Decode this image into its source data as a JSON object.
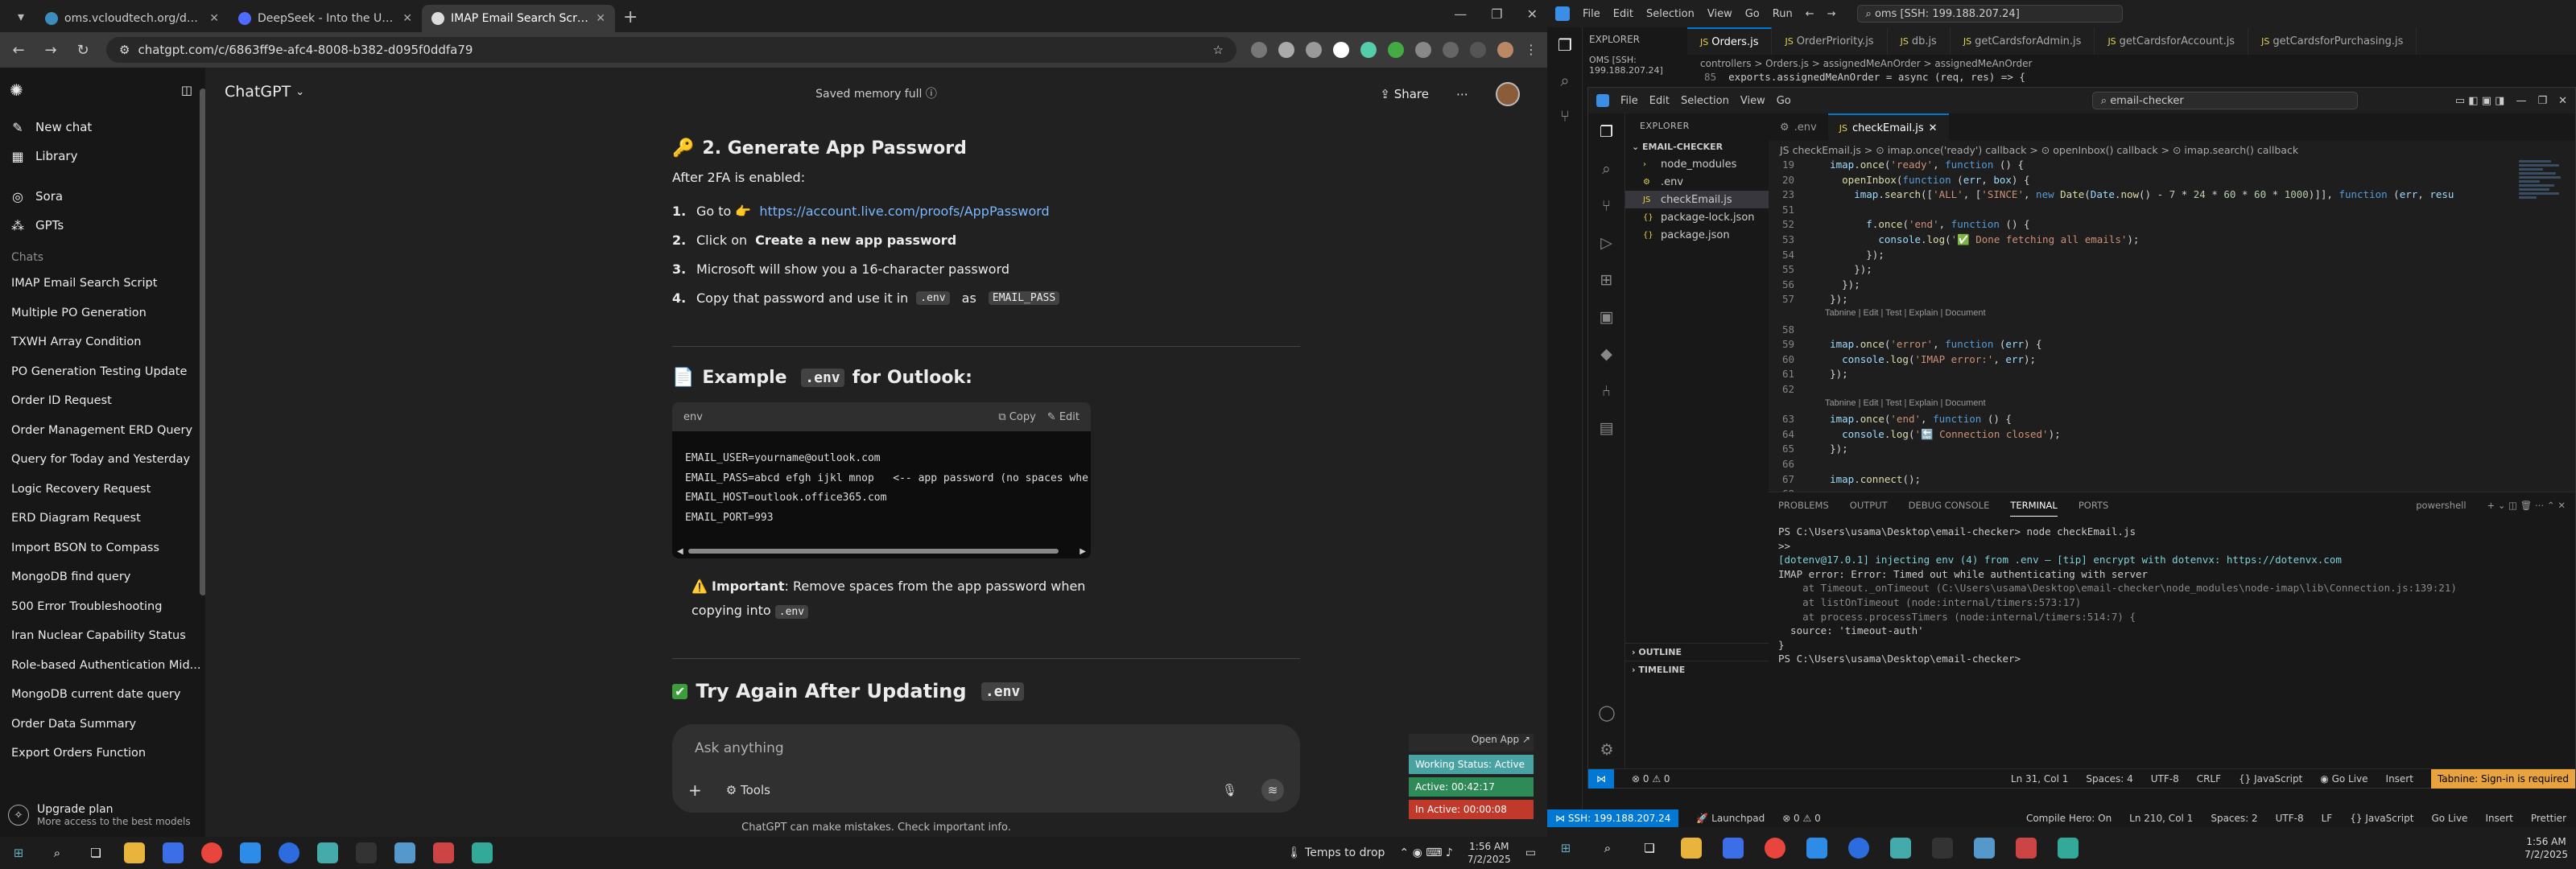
{
  "browser": {
    "tabs": [
      {
        "label": "oms.vcloudtech.org/dashboard",
        "color": "#3c8dbc"
      },
      {
        "label": "DeepSeek - Into the Unknown",
        "color": "#4d6bfe"
      },
      {
        "label": "IMAP Email Search Script",
        "color": "#dddddd"
      }
    ],
    "url": "chatgpt.com/c/6863ff9e-afc4-8008-b382-d095f0ddfa79"
  },
  "chatgpt": {
    "brand": "ChatGPT",
    "new_chat": "New chat",
    "library": "Library",
    "sora": "Sora",
    "gpts": "GPTs",
    "chats_heading": "Chats",
    "chats": [
      "IMAP Email Search Script",
      "Multiple PO Generation",
      "TXWH Array Condition",
      "PO Generation Testing Update",
      "Order ID Request",
      "Order Management ERD Query",
      "Query for Today and Yesterday",
      "Logic Recovery Request",
      "ERD Diagram Request",
      "Import BSON to Compass",
      "MongoDB find query",
      "500 Error Troubleshooting",
      "Iran Nuclear Capability Status",
      "Role-based Authentication Mid...",
      "MongoDB current date query",
      "Order Data Summary",
      "Export Orders Function"
    ],
    "upgrade": "Upgrade plan",
    "upgrade_sub": "More access to the best models",
    "memory": "Saved memory full",
    "share": "Share",
    "section2_title": "2. Generate App Password",
    "after": "After 2FA is enabled:",
    "steps": [
      {
        "n": "1.",
        "text": "Go to 👉 ",
        "link": "https://account.live.com/proofs/AppPassword"
      },
      {
        "n": "2.",
        "text": "Click on ",
        "bold": "Create a new app password"
      },
      {
        "n": "3.",
        "text": "Microsoft will show you a 16-character password"
      },
      {
        "n": "4.",
        "text": "Copy that password and use it in ",
        "code1": ".env",
        "mid": " as ",
        "code2": "EMAIL_PASS"
      }
    ],
    "example_title_pre": "Example ",
    "example_code": ".env",
    "example_title_post": " for Outlook:",
    "code_lang": "env",
    "copy": "Copy",
    "edit": "Edit",
    "code_lines": [
      "EMAIL_USER=yourname@outlook.com",
      "EMAIL_PASS=abcd efgh ijkl mnop   <-- app password (no spaces whe",
      "EMAIL_HOST=outlook.office365.com",
      "EMAIL_PORT=993"
    ],
    "important_label": "Important",
    "important_text": ": Remove spaces from the app password when copying into ",
    "important_code": ".env",
    "try_title_pre": "Try Again After Updating ",
    "try_code": ".env",
    "placeholder": "Ask anything",
    "tools": "Tools",
    "disclaimer": "ChatGPT can make mistakes. Check important info."
  },
  "tracker": {
    "open_app": "Open App",
    "status": "Working Status: Active",
    "active": "Active: 00:42:17",
    "inactive": "In Active: 00:00:08"
  },
  "left_taskbar": {
    "drop": "Temps to drop",
    "time": "1:56 AM",
    "date": "7/2/2025"
  },
  "vscode_outer": {
    "menu": [
      "File",
      "Edit",
      "Selection",
      "View",
      "Go",
      "Run"
    ],
    "search": "oms [SSH: 199.188.207.24]",
    "explorer": "EXPLORER",
    "remote": "OMS [SSH: 199.188.207.24]",
    "tabs": [
      "Orders.js",
      "OrderPriority.js",
      "db.js",
      "getCardsforAdmin.js",
      "getCardsforAccount.js",
      "getCardsforPurchasing.js"
    ],
    "breadcrumb": "controllers > Orders.js > assignedMeAnOrder > assignedMeAnOrder",
    "line85": "exports.assignedMeAnOrder = async (req, res) => {",
    "status_remote": "SSH: 199.188.207.24",
    "status_pos": "Ln 210, Col 1",
    "status_spaces": "Spaces: 2",
    "status_enc": "UTF-8",
    "status_eol": "LF",
    "status_lang": "JavaScript",
    "status_live": "Go Live",
    "status_insert": "Insert",
    "status_prettier": "Prettier",
    "status_herc": "Compile Hero: On",
    "status_launch": "Launchpad",
    "time": "1:56 AM",
    "date": "7/2/2025"
  },
  "vscode_inner": {
    "menu": [
      "File",
      "Edit",
      "Selection",
      "View",
      "Go"
    ],
    "search": "email-checker",
    "explorer": "EXPLORER",
    "folder": "EMAIL-CHECKER",
    "files": [
      {
        "name": "node_modules",
        "icon": "›"
      },
      {
        "name": ".env",
        "icon": "⚙"
      },
      {
        "name": "checkEmail.js",
        "icon": "JS",
        "sel": true
      },
      {
        "name": "package-lock.json",
        "icon": "{}"
      },
      {
        "name": "package.json",
        "icon": "{}"
      }
    ],
    "tabs": [
      ".env",
      "checkEmail.js"
    ],
    "breadcrumb": "JS checkEmail.js > ⊙ imap.once('ready') callback > ⊙ openInbox() callback > ⊙ imap.search() callback",
    "outline": "OUTLINE",
    "timeline": "TIMELINE",
    "panel_tabs": [
      "PROBLEMS",
      "OUTPUT",
      "DEBUG CONSOLE",
      "TERMINAL",
      "PORTS"
    ],
    "shell": "powershell",
    "terminal": [
      "PS C:\\Users\\usama\\Desktop\\email-checker> node checkEmail.js",
      ">>",
      "[dotenv@17.0.1] injecting env (4) from .env – [tip] encrypt with dotenvx: https://dotenvx.com",
      "IMAP error: Error: Timed out while authenticating with server",
      "    at Timeout._onTimeout (C:\\Users\\usama\\Desktop\\email-checker\\node_modules\\node-imap\\lib\\Connection.js:139:21)",
      "    at listOnTimeout (node:internal/timers:573:17)",
      "    at process.processTimers (node:internal/timers:514:7) {",
      "  source: 'timeout-auth'",
      "}",
      "PS C:\\Users\\usama\\Desktop\\email-checker> "
    ],
    "status_pos": "Ln 31, Col 1",
    "status_spaces": "Spaces: 4",
    "status_enc": "UTF-8",
    "status_eol": "CRLF",
    "status_lang": "JavaScript",
    "status_live": "Go Live",
    "status_insert": "Insert",
    "status_tabnine": "Tabnine: Sign-in is required",
    "status_err": "0",
    "status_warn": "0"
  },
  "code_lines": [
    {
      "n": "19",
      "html": "    <span class=\"va\">imap</span>.<span class=\"fn\">once</span>(<span class=\"st\">'ready'</span>, <span class=\"kw\">function</span> () {"
    },
    {
      "n": "20",
      "html": "      <span class=\"fn\">openInbox</span>(<span class=\"kw\">function</span> (<span class=\"va\">err</span>, <span class=\"va\">box</span>) {"
    },
    {
      "n": "23",
      "html": "        <span class=\"va\">imap</span>.<span class=\"fn\">search</span>([<span class=\"st\">'ALL'</span>, [<span class=\"st\">'SINCE'</span>, <span class=\"kw\">new</span> <span class=\"fn\">Date</span>(<span class=\"va\">Date</span>.<span class=\"fn\">now</span>() - <span class=\"nu\">7</span> * <span class=\"nu\">24</span> * <span class=\"nu\">60</span> * <span class=\"nu\">60</span> * <span class=\"nu\">1000</span>)]], <span class=\"kw\">function</span> (<span class=\"va\">err</span>, <span class=\"va\">resu</span>"
    },
    {
      "n": "51",
      "html": ""
    },
    {
      "n": "52",
      "html": "          <span class=\"va\">f</span>.<span class=\"fn\">once</span>(<span class=\"st\">'end'</span>, <span class=\"kw\">function</span> () {"
    },
    {
      "n": "53",
      "html": "            <span class=\"va\">console</span>.<span class=\"fn\">log</span>(<span class=\"st\">'✅ Done fetching all emails'</span>);"
    },
    {
      "n": "54",
      "html": "          });"
    },
    {
      "n": "55",
      "html": "        });"
    },
    {
      "n": "56",
      "html": "      });"
    },
    {
      "n": "57",
      "html": "    });"
    },
    {
      "n": "58",
      "lens": "Tabnine | Edit | Test | Explain | Document"
    },
    {
      "n": "58",
      "html": ""
    },
    {
      "n": "59",
      "html": "    <span class=\"va\">imap</span>.<span class=\"fn\">once</span>(<span class=\"st\">'error'</span>, <span class=\"kw\">function</span> (<span class=\"va\">err</span>) {"
    },
    {
      "n": "60",
      "html": "      <span class=\"va\">console</span>.<span class=\"fn\">log</span>(<span class=\"st\">'IMAP error:'</span>, <span class=\"va\">err</span>);"
    },
    {
      "n": "61",
      "html": "    });"
    },
    {
      "n": "62",
      "html": ""
    },
    {
      "n": "",
      "lens": "Tabnine | Edit | Test | Explain | Document"
    },
    {
      "n": "63",
      "html": "    <span class=\"va\">imap</span>.<span class=\"fn\">once</span>(<span class=\"st\">'end'</span>, <span class=\"kw\">function</span> () {"
    },
    {
      "n": "64",
      "html": "      <span class=\"va\">console</span>.<span class=\"fn\">log</span>(<span class=\"st\">'🔚 Connection closed'</span>);"
    },
    {
      "n": "65",
      "html": "    });"
    },
    {
      "n": "66",
      "html": ""
    },
    {
      "n": "67",
      "html": "    <span class=\"va\">imap</span>.<span class=\"fn\">connect</span>();"
    },
    {
      "n": "68",
      "html": ""
    }
  ]
}
